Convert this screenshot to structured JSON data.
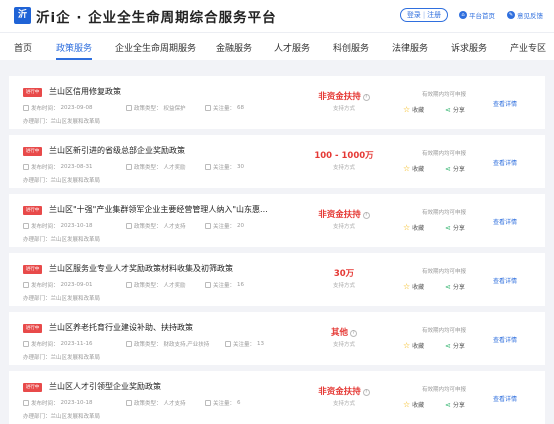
{
  "header": {
    "logo_text": "沂",
    "title": "沂i企 · 企业全生命周期综合服务平台",
    "login": "登录",
    "register": "注册",
    "platform_home": "平台首页",
    "feedback": "意见反馈"
  },
  "nav": {
    "items": [
      "首页",
      "政策服务",
      "企业全生命周期服务",
      "金融服务",
      "人才服务",
      "科创服务",
      "法律服务",
      "诉求服务",
      "产业专区"
    ],
    "active": "政策服务"
  },
  "labels": {
    "status": "进行中",
    "publish_prefix": "发布时间：",
    "type_prefix": "政策类型：",
    "follow_prefix": "关注量：",
    "dept_prefix": "办理部门：",
    "support_way": "支持方式",
    "valid_period": "有效期内均可申报",
    "favorite": "收藏",
    "share": "分享",
    "detail": "查看详情"
  },
  "policies": [
    {
      "title": "兰山区信用修复政策",
      "date": "2023-09-08",
      "type": "权益保护",
      "follows": "68",
      "dept": "兰山区发展和改革局",
      "amount": "非资金扶持",
      "info": true
    },
    {
      "title": "兰山区新引进的省级总部企业奖励政策",
      "date": "2023-08-31",
      "type": "人才奖励",
      "follows": "30",
      "dept": "兰山区发展和改革局",
      "amount": "100 - 1000万",
      "info": false
    },
    {
      "title": "兰山区\"十强\"产业集群领军企业主要经营管理人纳入\"山东惠...",
      "date": "2023-10-18",
      "type": "人才支持",
      "follows": "20",
      "dept": "兰山区发展和改革局",
      "amount": "非资金扶持",
      "info": true
    },
    {
      "title": "兰山区服务业专业人才奖励政策材料收集及初筛政策",
      "date": "2023-09-01",
      "type": "人才奖励",
      "follows": "16",
      "dept": "兰山区发展和改革局",
      "amount": "30万",
      "info": false
    },
    {
      "title": "兰山区养老托育行业建设补助、扶持政策",
      "date": "2023-11-16",
      "type": "财政支持,产业扶持",
      "follows": "13",
      "dept": "兰山区发展和改革局",
      "amount": "其他",
      "info": true
    },
    {
      "title": "兰山区人才引领型企业奖励政策",
      "date": "2023-10-18",
      "type": "人才支持",
      "follows": "6",
      "dept": "兰山区发展和改革局",
      "amount": "非资金扶持",
      "info": true
    }
  ]
}
